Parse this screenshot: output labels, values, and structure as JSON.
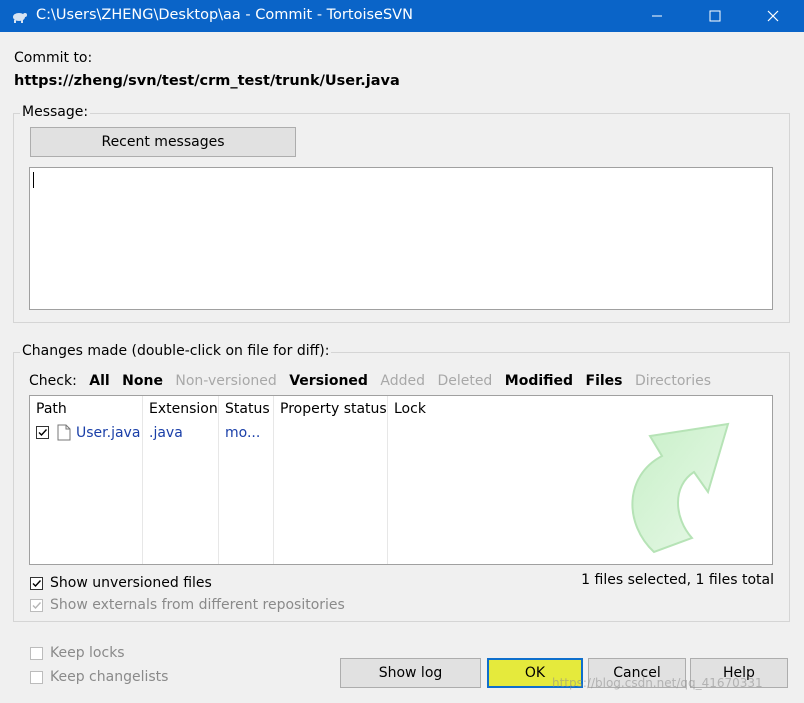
{
  "window": {
    "title": "C:\\Users\\ZHENG\\Desktop\\aa - Commit - TortoiseSVN",
    "icon": "tortoise-icon",
    "controls": [
      "minimize-icon",
      "maximize-icon",
      "close-icon"
    ]
  },
  "commit": {
    "label": "Commit to:",
    "url": "https://zheng/svn/test/crm_test/trunk/User.java"
  },
  "message": {
    "group_label": "Message:",
    "recent_button": "Recent messages",
    "text": ""
  },
  "changes": {
    "group_label": "Changes made (double-click on file for diff):",
    "check_label": "Check:",
    "filters": [
      {
        "label": "All",
        "enabled": true
      },
      {
        "label": "None",
        "enabled": true
      },
      {
        "label": "Non-versioned",
        "enabled": false
      },
      {
        "label": "Versioned",
        "enabled": true
      },
      {
        "label": "Added",
        "enabled": false
      },
      {
        "label": "Deleted",
        "enabled": false
      },
      {
        "label": "Modified",
        "enabled": true
      },
      {
        "label": "Files",
        "enabled": true
      },
      {
        "label": "Directories",
        "enabled": false
      }
    ],
    "columns": [
      "Path",
      "Extension",
      "Status",
      "Property status",
      "Lock"
    ],
    "rows": [
      {
        "checked": true,
        "path": "User.java",
        "extension": ".java",
        "status": "mo...",
        "property_status": "",
        "lock": ""
      }
    ],
    "options": {
      "show_unversioned": {
        "label": "Show unversioned files",
        "checked": true
      },
      "show_externals": {
        "label": "Show externals from different repositories",
        "checked": true
      }
    },
    "selection_summary": "1 files selected, 1 files total"
  },
  "footer": {
    "keep_locks": {
      "label": "Keep locks",
      "checked": false
    },
    "keep_changelists": {
      "label": "Keep changelists",
      "checked": false
    },
    "buttons": {
      "show_log": "Show log",
      "ok": "OK",
      "cancel": "Cancel",
      "help": "Help"
    },
    "watermark": "https://blog.csdn.net/qq_41670331"
  },
  "colors": {
    "titlebar": "#0a64c8",
    "ok_highlight": "#e5ea3c",
    "file_text": "#1a3fa8",
    "disabled_text": "#a8a8a8"
  }
}
